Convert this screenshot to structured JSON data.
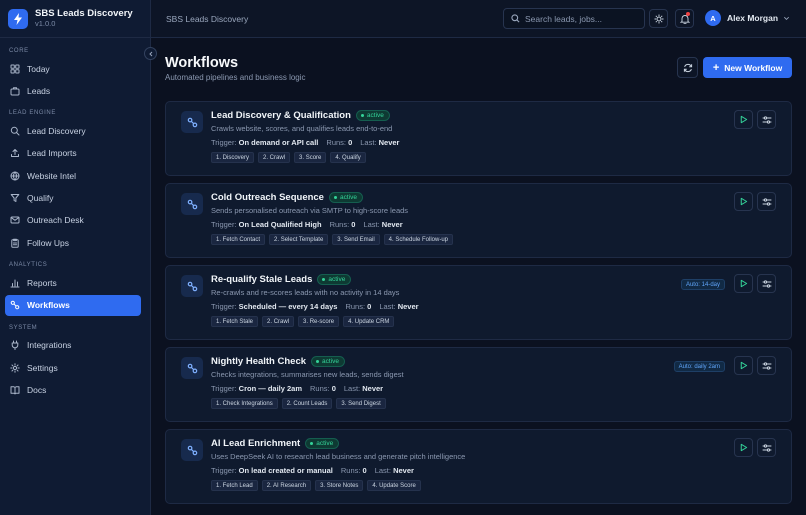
{
  "app": {
    "name": "SBS Leads Discovery",
    "version": "v1.0.0"
  },
  "colors": {
    "accent": "#2f6bf0",
    "active_badge": "#34d399",
    "background": "#0b1120"
  },
  "sidebar": {
    "groups": [
      {
        "label": "CORE",
        "items": [
          {
            "label": "Today",
            "icon": "grid-icon"
          },
          {
            "label": "Leads",
            "icon": "briefcase-icon"
          }
        ]
      },
      {
        "label": "LEAD ENGINE",
        "items": [
          {
            "label": "Lead Discovery",
            "icon": "search-icon"
          },
          {
            "label": "Lead Imports",
            "icon": "upload-icon"
          },
          {
            "label": "Website Intel",
            "icon": "globe-icon"
          },
          {
            "label": "Qualify",
            "icon": "filter-icon"
          },
          {
            "label": "Outreach Desk",
            "icon": "send-icon"
          },
          {
            "label": "Follow Ups",
            "icon": "clipboard-icon"
          }
        ]
      },
      {
        "label": "ANALYTICS",
        "items": [
          {
            "label": "Reports",
            "icon": "bar-chart-icon"
          },
          {
            "label": "Workflows",
            "icon": "workflow-icon",
            "active": true
          }
        ]
      },
      {
        "label": "SYSTEM",
        "items": [
          {
            "label": "Integrations",
            "icon": "plug-icon"
          },
          {
            "label": "Settings",
            "icon": "gear-icon"
          },
          {
            "label": "Docs",
            "icon": "book-icon"
          }
        ]
      }
    ]
  },
  "topbar": {
    "breadcrumb": "SBS Leads Discovery",
    "search_placeholder": "Search leads, jobs...",
    "user_initial": "A",
    "user_name": "Alex Morgan"
  },
  "page": {
    "title": "Workflows",
    "subtitle": "Automated pipelines and business logic",
    "new_button": "New Workflow"
  },
  "labels": {
    "trigger": "Trigger:",
    "runs": "Runs:",
    "last": "Last:"
  },
  "workflows": [
    {
      "title": "Lead Discovery & Qualification",
      "status": "active",
      "description": "Crawls website, scores, and qualifies leads end-to-end",
      "trigger": "On demand or API call",
      "runs": "0",
      "last": "Never",
      "schedule": "",
      "steps": [
        "1. Discovery",
        "2. Crawl",
        "3. Score",
        "4. Qualify"
      ]
    },
    {
      "title": "Cold Outreach Sequence",
      "status": "active",
      "description": "Sends personalised outreach via SMTP to high-score leads",
      "trigger": "On Lead Qualified High",
      "runs": "0",
      "last": "Never",
      "schedule": "",
      "steps": [
        "1. Fetch Contact",
        "2. Select Template",
        "3. Send Email",
        "4. Schedule Follow-up"
      ]
    },
    {
      "title": "Re-qualify Stale Leads",
      "status": "active",
      "description": "Re-crawls and re-scores leads with no activity in 14 days",
      "trigger": "Scheduled — every 14 days",
      "runs": "0",
      "last": "Never",
      "schedule": "Auto: 14-day",
      "steps": [
        "1. Fetch Stale",
        "2. Crawl",
        "3. Re-score",
        "4. Update CRM"
      ]
    },
    {
      "title": "Nightly Health Check",
      "status": "active",
      "description": "Checks integrations, summarises new leads, sends digest",
      "trigger": "Cron — daily 2am",
      "runs": "0",
      "last": "Never",
      "schedule": "Auto: daily 2am",
      "steps": [
        "1. Check Integrations",
        "2. Count Leads",
        "3. Send Digest"
      ]
    },
    {
      "title": "AI Lead Enrichment",
      "status": "active",
      "description": "Uses DeepSeek AI to research lead business and generate pitch intelligence",
      "trigger": "On lead created or manual",
      "runs": "0",
      "last": "Never",
      "schedule": "",
      "steps": [
        "1. Fetch Lead",
        "2. AI Research",
        "3. Store Notes",
        "4. Update Score"
      ]
    }
  ]
}
